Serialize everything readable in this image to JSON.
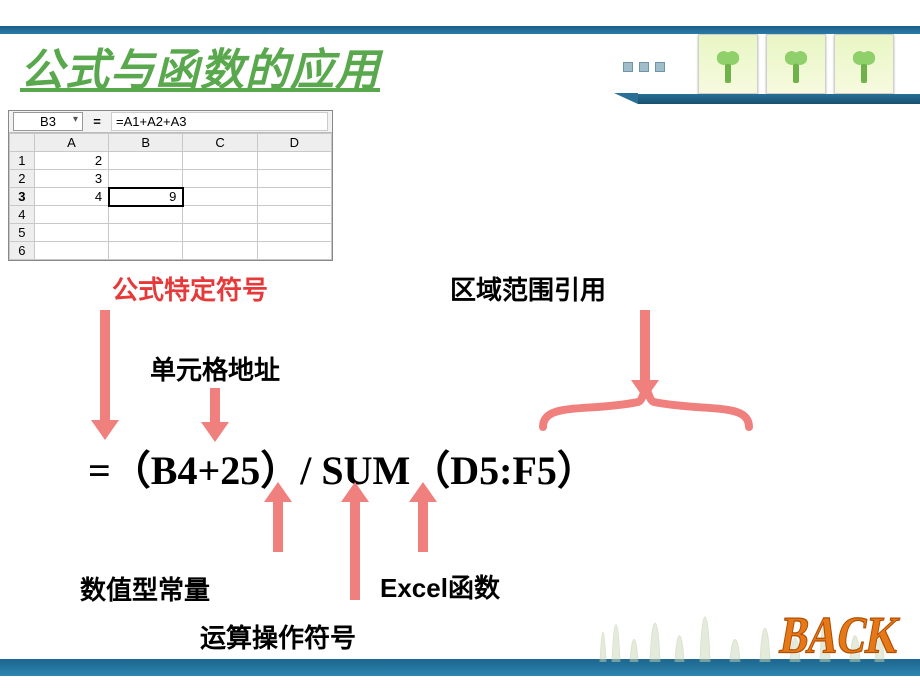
{
  "title": "公式与函数的应用",
  "excel": {
    "namebox": "B3",
    "formula_bar": "=A1+A2+A3",
    "columns": [
      "A",
      "B",
      "C",
      "D"
    ],
    "rows": [
      {
        "n": "1",
        "A": "2",
        "B": "",
        "C": "",
        "D": ""
      },
      {
        "n": "2",
        "A": "3",
        "B": "",
        "C": "",
        "D": ""
      },
      {
        "n": "3",
        "A": "4",
        "B": "9",
        "C": "",
        "D": "",
        "selected": true
      },
      {
        "n": "4",
        "A": "",
        "B": "",
        "C": "",
        "D": ""
      },
      {
        "n": "5",
        "A": "",
        "B": "",
        "C": "",
        "D": ""
      },
      {
        "n": "6",
        "A": "",
        "B": "",
        "C": "",
        "D": ""
      }
    ]
  },
  "labels": {
    "formula_symbol": "公式特定符号",
    "range_ref": "区域范围引用",
    "cell_addr": "单元格地址",
    "numeric_const": "数值型常量",
    "excel_func": "Excel函数",
    "operator": "运算操作符号"
  },
  "formula": "=（B4+25）/ SUM（D5:F5）",
  "back_text": "BACK"
}
